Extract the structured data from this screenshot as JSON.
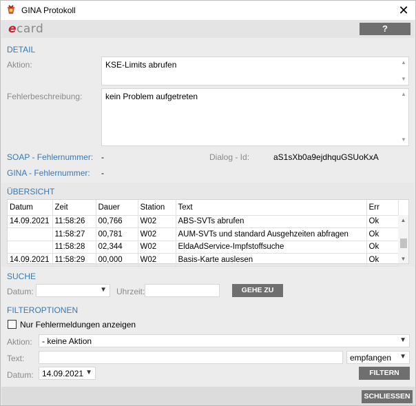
{
  "window": {
    "title": "GINA Protokoll",
    "close_symbol": "✕"
  },
  "logo": {
    "e": "e",
    "card": "card"
  },
  "help_label": "?",
  "detail": {
    "section": "DETAIL",
    "aktion_label": "Aktion:",
    "aktion_value": "KSE-Limits abrufen",
    "fehler_label": "Fehlerbeschreibung:",
    "fehler_value": "kein Problem aufgetreten",
    "soap_label": "SOAP - Fehlernummer:",
    "soap_value": "-",
    "dialog_label": "Dialog - Id:",
    "dialog_value": "aS1sXb0a9ejdhquGSUoKxA",
    "gina_label": "GINA - Fehlernummer:",
    "gina_value": "-"
  },
  "overview": {
    "section": "ÜBERSICHT",
    "columns": [
      "Datum",
      "Zeit",
      "Dauer",
      "Station",
      "Text",
      "Err"
    ],
    "rows": [
      [
        "14.09.2021",
        "11:58:26",
        "00,766",
        "W02",
        "ABS-SVTs abrufen",
        "Ok"
      ],
      [
        "",
        "11:58:27",
        "00,781",
        "W02",
        "AUM-SVTs und standard Ausgehzeiten abfragen",
        "Ok"
      ],
      [
        "",
        "11:58:28",
        "02,344",
        "W02",
        "EldaAdService-Impfstoffsuche",
        "Ok"
      ],
      [
        "14.09.2021",
        "11:58:29",
        "00,000",
        "W02",
        "Basis-Karte auslesen",
        "Ok"
      ]
    ]
  },
  "search": {
    "section": "SUCHE",
    "datum_label": "Datum:",
    "datum_value": "",
    "uhrzeit_label": "Uhrzeit:",
    "uhrzeit_value": "",
    "gehe_zu": "GEHE ZU"
  },
  "filter": {
    "section": "FILTEROPTIONEN",
    "checkbox_label": "Nur Fehlermeldungen anzeigen",
    "aktion_label": "Aktion:",
    "aktion_value": "- keine Aktion",
    "text_label": "Text:",
    "text_value": "",
    "direction_value": "empfangen",
    "datum_label": "Datum:",
    "datum_value": "14.09.2021",
    "filter_button": "FILTERN"
  },
  "close_button": "SCHLIESSEN",
  "colors": {
    "accent_blue": "#3678b5",
    "button_gray": "#6f6f6f",
    "brand_red": "#c8242d"
  }
}
